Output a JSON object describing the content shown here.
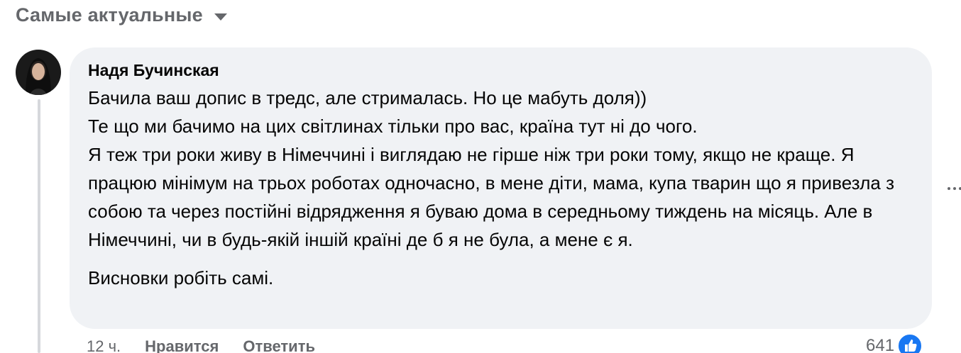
{
  "sort": {
    "label": "Самые актуальные",
    "icon": "caret-down-icon"
  },
  "comment": {
    "author": "Надя Бучинская",
    "paragraphs": [
      "Бачила ваш допис в тредс, але стрималась. Но це мабуть доля))",
      "Те що ми бачимо на цих світлинах тільки про вас, країна тут ні до чого.",
      "Я теж три роки живу в Німеччині і виглядаю не гірше ніж три роки тому, якщо не краще. Я працюю мінімум на трьох роботах одночасно, в мене діти, мама, купа тварин що я привезла з собою та через постійні відрядження я буваю дома в середньому тиждень на місяць. Але в Німеччині, чи в будь-якій іншій країні де б я не була, а мене є я.",
      "Висновки робіть самі."
    ],
    "time": "12 ч.",
    "like_label": "Нравится",
    "reply_label": "Ответить",
    "reaction_count": "641",
    "reaction_icon": "like-icon"
  },
  "colors": {
    "bubble_bg": "#f0f2f5",
    "secondary_text": "#65676b",
    "like_blue": "#1877f2"
  }
}
